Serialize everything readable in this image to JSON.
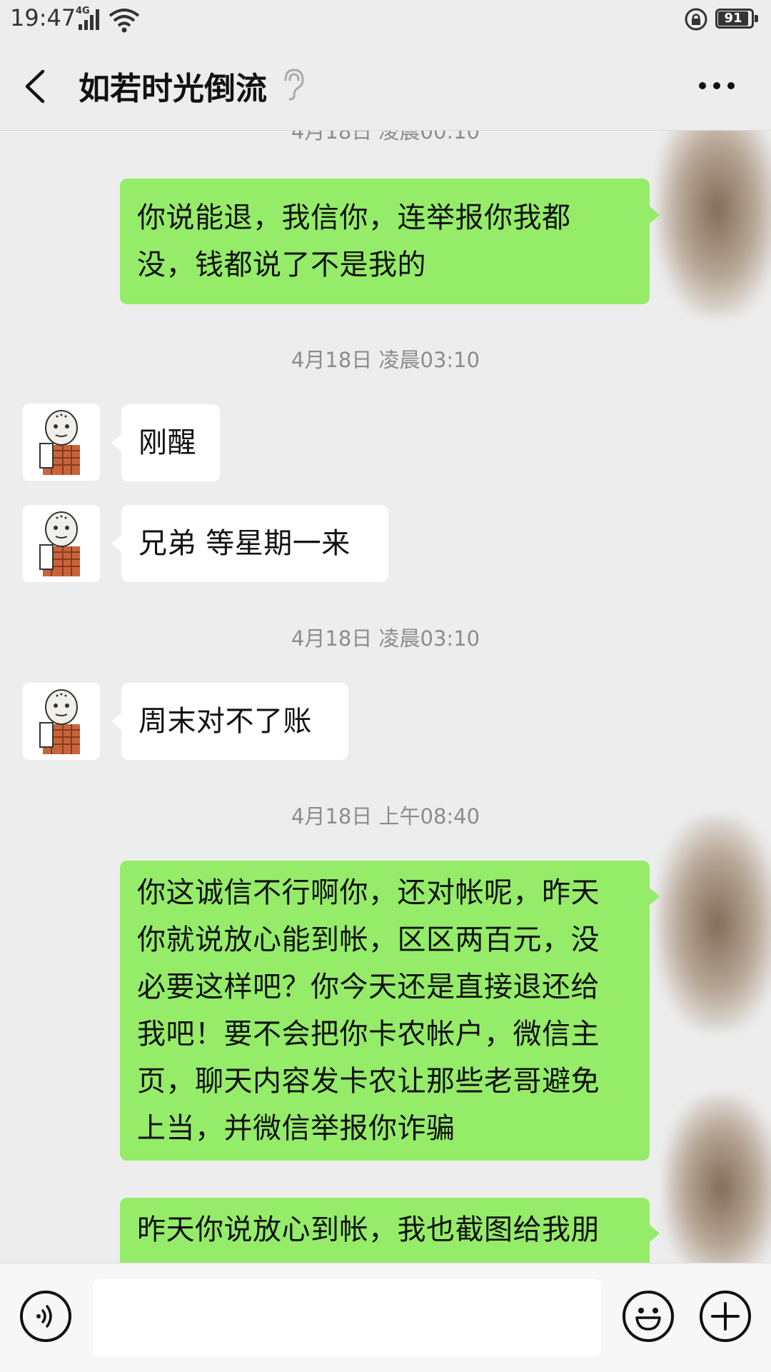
{
  "status_bar": {
    "time": "19:47",
    "network": "4G",
    "battery": "91"
  },
  "header": {
    "title": "如若时光倒流",
    "back_icon": "chevron-left-icon",
    "earpiece_icon": "ear-icon",
    "more_icon": "more-dots-icon"
  },
  "messages": [
    {
      "type": "timestamp",
      "text": "4月18日 凌晨00:10"
    },
    {
      "type": "sent",
      "text": "你说能退，我信你，连举报你我都\n没，钱都说了不是我的"
    },
    {
      "type": "timestamp",
      "text": "4月18日 凌晨03:10"
    },
    {
      "type": "received",
      "text": "刚醒"
    },
    {
      "type": "received",
      "text": "兄弟 等星期一来"
    },
    {
      "type": "timestamp",
      "text": "4月18日 凌晨03:10"
    },
    {
      "type": "received",
      "text": "周末对不了账"
    },
    {
      "type": "timestamp",
      "text": "4月18日 上午08:40"
    },
    {
      "type": "sent",
      "text": "你这诚信不行啊你，还对帐呢，昨天\n你就说放心能到帐，区区两百元，没\n必要这样吧？你今天还是直接退还给\n我吧！要不会把你卡农帐户，微信主\n页，聊天内容发卡农让那些老哥避免\n上当，并微信举报你诈骗"
    },
    {
      "type": "sent",
      "text": "昨天你说放心到帐，我也截图给我朋"
    }
  ],
  "input_bar": {
    "voice_icon": "voice-icon",
    "input_value": "",
    "emoji_icon": "emoji-icon",
    "plus_icon": "plus-icon"
  },
  "colors": {
    "background": "#ededed",
    "sent_bubble": "#95ec69",
    "received_bubble": "#ffffff",
    "timestamp_text": "#8c8c8c"
  }
}
